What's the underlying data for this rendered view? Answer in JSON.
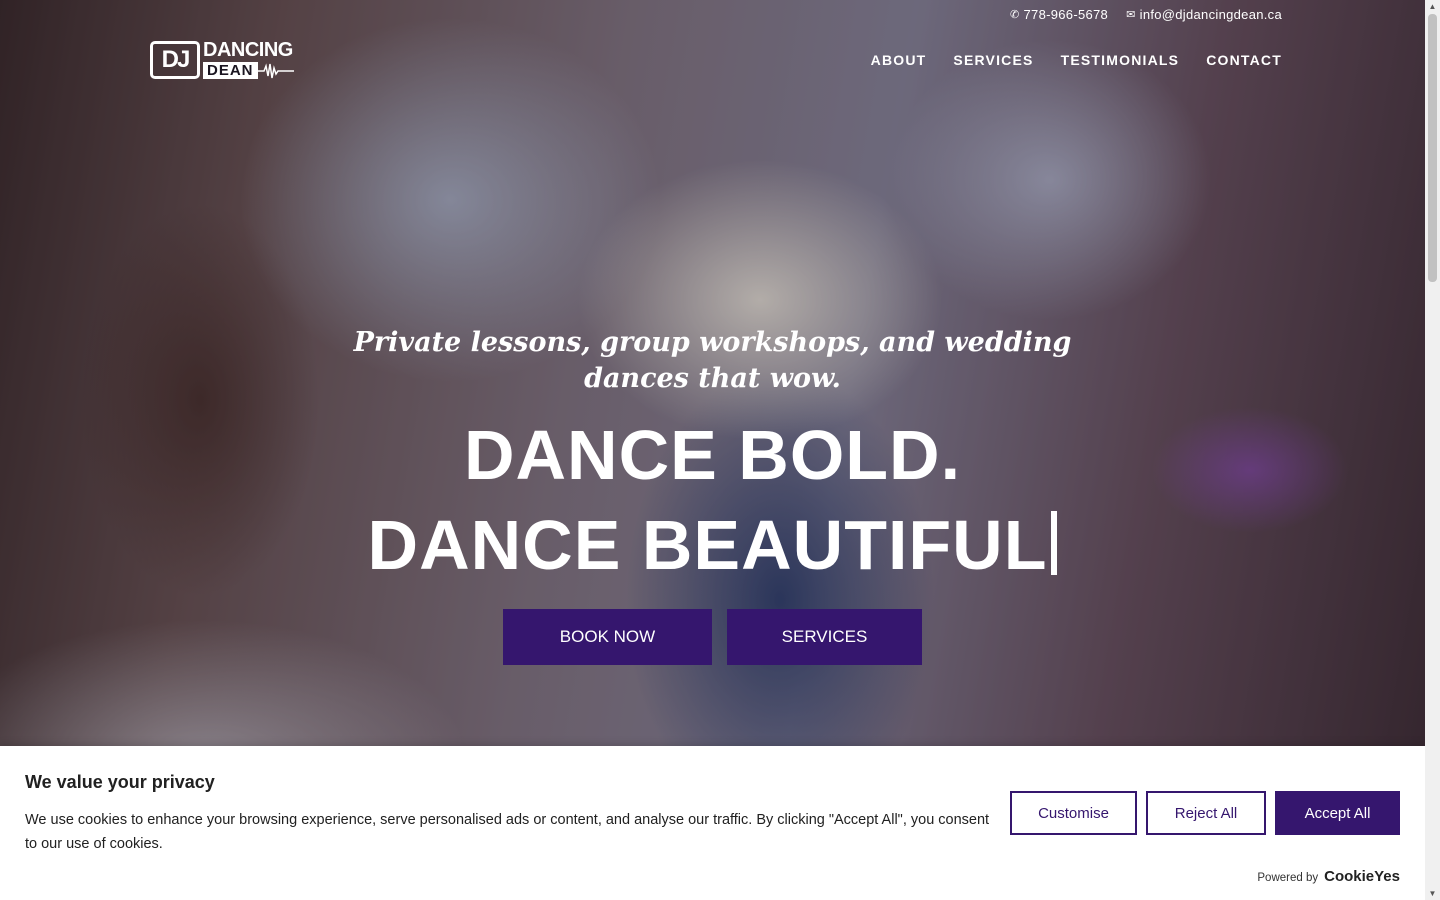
{
  "topbar": {
    "phone": "778-966-5678",
    "email": "info@djdancingdean.ca"
  },
  "logo": {
    "mark": "DJ",
    "line1": "DANCING",
    "line2": "DEAN"
  },
  "nav": {
    "items": [
      "ABOUT",
      "SERVICES",
      "TESTIMONIALS",
      "CONTACT"
    ]
  },
  "hero": {
    "tagline": "Private lessons, group workshops, and wedding dances that wow.",
    "headline_line1": "DANCE BOLD.",
    "headline_line2": "DANCE BEAUTIFUL",
    "book_button": "BOOK NOW",
    "services_button": "SERVICES"
  },
  "cookie": {
    "title": "We value your privacy",
    "text": "We use cookies to enhance your browsing experience, serve personalised ads or content, and analyse our traffic. By clicking \"Accept All\", you consent to our use of cookies.",
    "customise": "Customise",
    "reject": "Reject All",
    "accept": "Accept All",
    "powered_by": "Powered by",
    "brand": "CookieYes"
  },
  "colors": {
    "accent": "#35166e",
    "text_dark": "#212121"
  }
}
